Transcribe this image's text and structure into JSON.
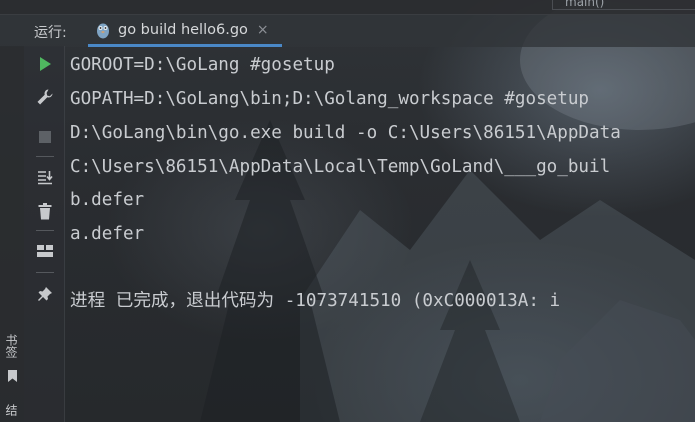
{
  "top": {
    "editor_tab": "main()"
  },
  "run_window": {
    "label": "运行:",
    "tab_title": "go build hello6.go",
    "tab_close": "×"
  },
  "side": {
    "bookmarks_label": "书签",
    "structure_label": "结构"
  },
  "toolbar": [
    {
      "name": "rerun-icon"
    },
    {
      "name": "wrench-icon"
    },
    {
      "name": "stop-icon"
    },
    {
      "name": "scroll-to-end-icon"
    },
    {
      "name": "trash-icon"
    },
    {
      "name": "layout-icon"
    },
    {
      "name": "pin-icon"
    }
  ],
  "console": {
    "lines": [
      "GOROOT=D:\\GoLang #gosetup",
      "GOPATH=D:\\GoLang\\bin;D:\\Golang_workspace #gosetup",
      "D:\\GoLang\\bin\\go.exe build -o C:\\Users\\86151\\AppData",
      "C:\\Users\\86151\\AppData\\Local\\Temp\\GoLand\\___go_buil",
      "b.defer",
      "a.defer",
      "",
      "进程 已完成，退出代码为 -1073741510 (0xC000013A: i"
    ]
  },
  "colors": {
    "accent": "#4a88c7",
    "run_green": "#4fb860",
    "text": "#c9ccd0"
  }
}
